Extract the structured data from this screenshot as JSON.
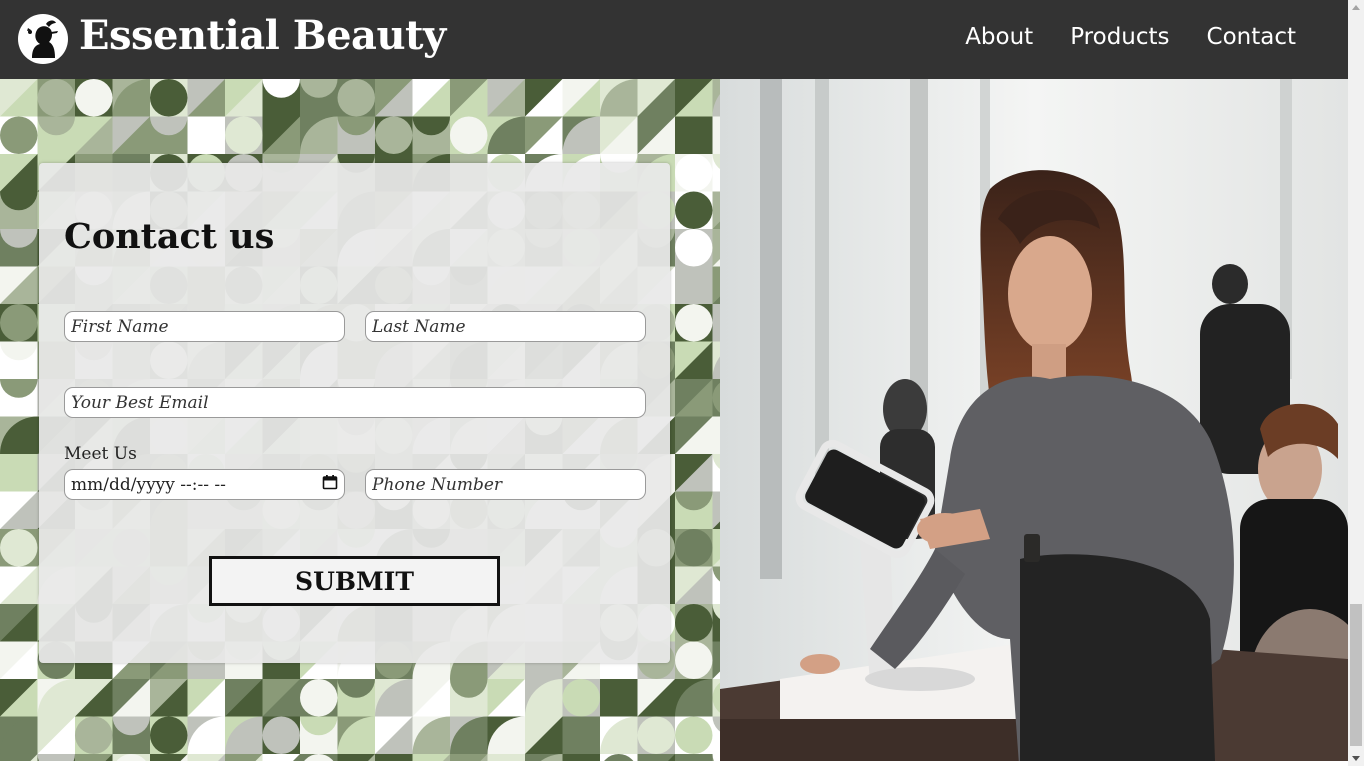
{
  "header": {
    "brand": "Essential Beauty",
    "nav": [
      {
        "label": "About"
      },
      {
        "label": "Products"
      },
      {
        "label": "Contact"
      }
    ]
  },
  "contact_form": {
    "title": "Contact us",
    "first_name_placeholder": "First Name",
    "last_name_placeholder": "Last Name",
    "email_placeholder": "Your Best Email",
    "meet_label": "Meet Us",
    "date_value": "mm/dd/yyyy --:-- --",
    "phone_placeholder": "Phone Number",
    "submit_label": "SUBMIT"
  },
  "colors": {
    "navbar": "#333333",
    "pattern_dark": "#4a5d38",
    "pattern_mid": "#8a9a78",
    "pattern_light": "#c9dbb5",
    "card": "#e8e8e8"
  },
  "icons": {
    "logo": "woman-silhouette-icon",
    "calendar": "calendar-icon"
  }
}
